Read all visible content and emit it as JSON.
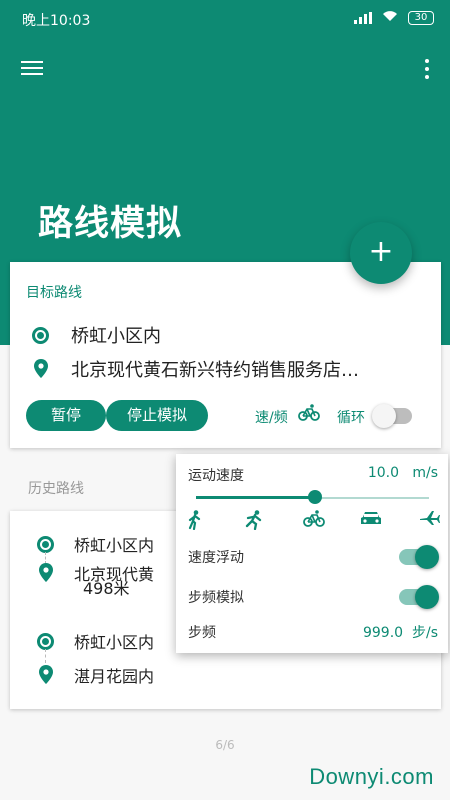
{
  "status_bar": {
    "time": "晚上10:03",
    "battery": "30"
  },
  "app_bar": {
    "title": "路线模拟"
  },
  "target_card": {
    "label": "目标路线",
    "start": "桥虹小区内",
    "end": "北京现代黄石新兴特约销售服务店…",
    "pause_label": "暂停",
    "stop_label": "停止模拟",
    "speed_freq_label": "速/频",
    "loop_label": "循环",
    "loop_enabled": false
  },
  "history": {
    "header": "历史路线",
    "routes": [
      {
        "start": "桥虹小区内",
        "end": "北京现代黄",
        "distance": "498米"
      },
      {
        "start": "桥虹小区内",
        "end": "湛月花园内"
      }
    ]
  },
  "speed_panel": {
    "speed_label": "运动速度",
    "speed_value": "10.0",
    "speed_unit": "m/s",
    "slider_position": 0.51,
    "modes": [
      "walk-icon",
      "run-icon",
      "bike-icon",
      "car-icon",
      "plane-icon"
    ],
    "selected_mode": "bike-icon",
    "speed_float_label": "速度浮动",
    "speed_float_enabled": true,
    "step_sim_label": "步频模拟",
    "step_sim_enabled": true,
    "step_freq_label": "步频",
    "step_freq_value": "999.0",
    "step_freq_unit": "步/s"
  },
  "page_indicator": "6/6",
  "watermark": "Downyi.com",
  "colors": {
    "primary": "#0d8a73",
    "primary_light": "#86c6b9"
  }
}
